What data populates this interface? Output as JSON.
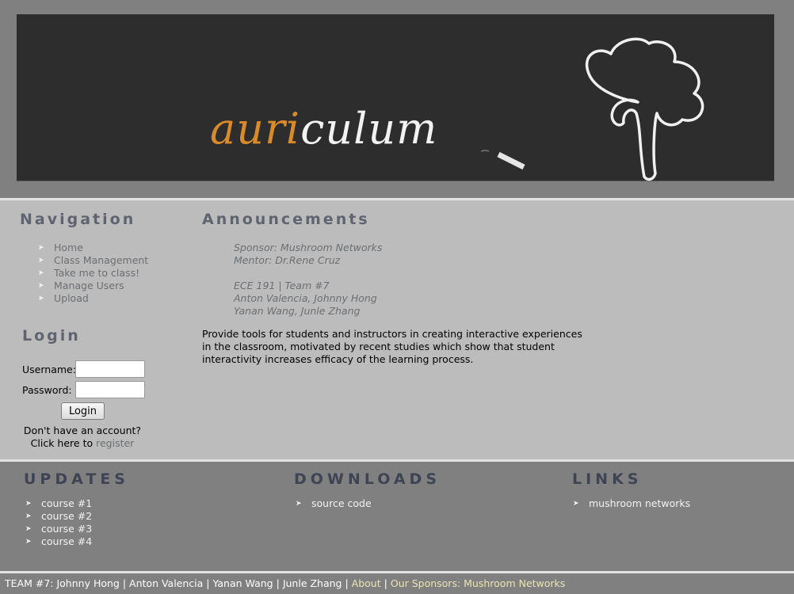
{
  "header": {
    "logo": {
      "accent": "auri",
      "rest": "culum"
    },
    "colors": {
      "banner_bg": "#2d2d2d",
      "accent": "#d98a2b"
    }
  },
  "navigation": {
    "title": "Navigation",
    "items": [
      "Home",
      "Class Management",
      "Take me to class!",
      "Manage Users",
      "Upload"
    ]
  },
  "login": {
    "title": "Login",
    "username_label": "Username:",
    "username_value": "",
    "password_label": "Password:",
    "password_value": "",
    "button_label": "Login",
    "no_account_text": "Don't have an account?",
    "click_here_text": "Click here to",
    "register_link": "register"
  },
  "announcements": {
    "title": "Announcements",
    "lines_1": [
      "Sponsor: Mushroom Networks",
      "Mentor: Dr.Rene Cruz"
    ],
    "lines_2": [
      "ECE 191 | Team #7",
      "Anton Valencia, Johnny Hong",
      "Yanan Wang, Junle Zhang"
    ],
    "description": "Provide tools for students and instructors in creating interactive experiences in the classroom, motivated by recent studies which show that student interactivity increases efficacy of the learning process."
  },
  "updates": {
    "title": "UPDATES",
    "items": [
      "course #1",
      "course #2",
      "course #3",
      "course #4"
    ]
  },
  "downloads": {
    "title": "DOWNLOADS",
    "items": [
      "source code"
    ]
  },
  "links": {
    "title": "LINKS",
    "items": [
      "mushroom networks"
    ]
  },
  "footer": {
    "team_label": "TEAM #7:",
    "members": [
      "Johnny Hong",
      "Anton Valencia",
      "Yanan Wang",
      "Junle Zhang"
    ],
    "about_link": "About",
    "sponsors_link": "Our Sponsors: Mushroom Networks",
    "separator": "|"
  }
}
